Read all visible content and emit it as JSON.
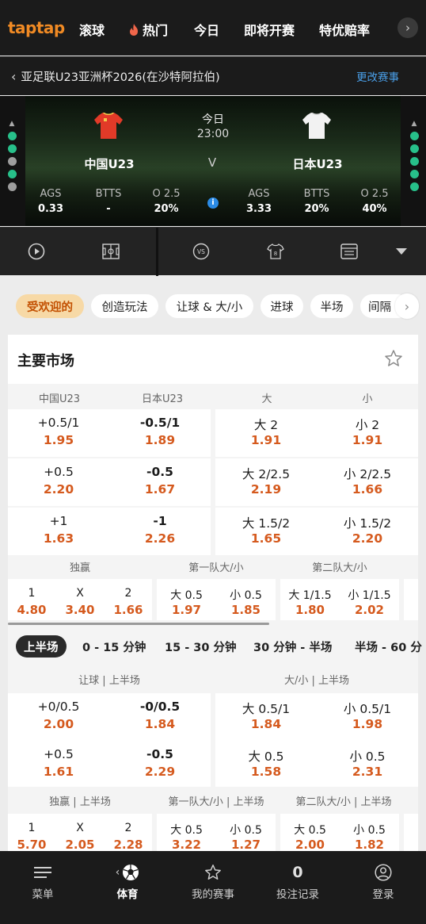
{
  "topnav": {
    "logo": "taptap",
    "items": [
      "滚球",
      "热门",
      "今日",
      "即将开赛",
      "特优赔率"
    ],
    "hot_icon": "flame-icon",
    "more_icon": "chevron-right-icon"
  },
  "breadcrumb": {
    "back_icon": "chevron-left-icon",
    "title": "亚足联U23亚洲杯2026(在沙特阿拉伯)",
    "change_link": "更改赛事"
  },
  "match": {
    "day": "今日",
    "time": "23:00",
    "vs": "V",
    "home": {
      "name": "中国U23",
      "jersey_color": "#e23a28",
      "collar_color": "#f2c94c"
    },
    "away": {
      "name": "日本U23",
      "jersey_color": "#f2f2f2",
      "collar_color": "#d9d9d9"
    },
    "home_form": [
      "#27c08a",
      "#27c08a",
      "#9e9e9e",
      "#27c08a",
      "#9e9e9e"
    ],
    "away_form": [
      "#27c08a",
      "#27c08a",
      "#27c08a",
      "#27c08a",
      "#27c08a"
    ],
    "stats_home": [
      {
        "label": "AGS",
        "value": "0.33"
      },
      {
        "label": "BTTS",
        "value": "-"
      },
      {
        "label": "O 2.5",
        "value": "20%"
      }
    ],
    "stats_away": [
      {
        "label": "AGS",
        "value": "3.33"
      },
      {
        "label": "BTTS",
        "value": "20%"
      },
      {
        "label": "O 2.5",
        "value": "40%"
      }
    ],
    "info_icon": "info-icon"
  },
  "iconbar": [
    "play-icon",
    "pitch-icon",
    "vs-icon",
    "jersey-icon",
    "scoreboard-icon",
    "dropdown-triangle-icon"
  ],
  "chips": [
    "受欢迎的",
    "创造玩法",
    "让球 & 大/小",
    "进球",
    "半场",
    "间隔"
  ],
  "main_market": {
    "title": "主要市场",
    "col_headers": [
      "中国U23",
      "日本U23",
      "大",
      "小"
    ],
    "handicap_rows": [
      {
        "home_line": "+0.5/1",
        "home_odds": "1.95",
        "away_line": "-0.5/1",
        "away_odds": "1.89",
        "over_line": "大 2",
        "over_odds": "1.91",
        "under_line": "小 2",
        "under_odds": "1.91"
      },
      {
        "home_line": "+0.5",
        "home_odds": "2.20",
        "away_line": "-0.5",
        "away_odds": "1.67",
        "over_line": "大 2/2.5",
        "over_odds": "2.19",
        "under_line": "小 2/2.5",
        "under_odds": "1.66"
      },
      {
        "home_line": "+1",
        "home_odds": "1.63",
        "away_line": "-1",
        "away_odds": "2.26",
        "over_line": "大 1.5/2",
        "over_odds": "1.65",
        "under_line": "小 1.5/2",
        "under_odds": "2.20"
      }
    ],
    "group_headers": [
      "独赢",
      "第一队大/小",
      "第二队大/小"
    ],
    "moneyline": [
      {
        "label": "1",
        "odds": "4.80"
      },
      {
        "label": "X",
        "odds": "3.40"
      },
      {
        "label": "2",
        "odds": "1.66"
      }
    ],
    "team1_ou": [
      {
        "label": "大 0.5",
        "odds": "1.97"
      },
      {
        "label": "小 0.5",
        "odds": "1.85"
      }
    ],
    "team2_ou": [
      {
        "label": "大 1/1.5",
        "odds": "1.80"
      },
      {
        "label": "小 1/1.5",
        "odds": "2.02"
      }
    ]
  },
  "period_tabs": [
    "上半场",
    "0 - 15 分钟",
    "15 - 30 分钟",
    "30 分钟 - 半场",
    "半场 - 60 分"
  ],
  "first_half": {
    "header_handicap": "让球 | 上半场",
    "header_ou": "大/小 | 上半场",
    "rows": [
      {
        "home_line": "+0/0.5",
        "home_odds": "2.00",
        "away_line": "-0/0.5",
        "away_odds": "1.84",
        "over_line": "大 0.5/1",
        "over_odds": "1.84",
        "under_line": "小 0.5/1",
        "under_odds": "1.98"
      },
      {
        "home_line": "+0.5",
        "home_odds": "1.61",
        "away_line": "-0.5",
        "away_odds": "2.29",
        "over_line": "大 0.5",
        "over_odds": "1.58",
        "under_line": "小 0.5",
        "under_odds": "2.31"
      }
    ],
    "group_headers": [
      "独赢 | 上半场",
      "第一队大/小 | 上半场",
      "第二队大/小 | 上半场"
    ],
    "moneyline": [
      {
        "label": "1",
        "odds": "5.70"
      },
      {
        "label": "X",
        "odds": "2.05"
      },
      {
        "label": "2",
        "odds": "2.28"
      }
    ],
    "team1_ou": [
      {
        "label": "大 0.5",
        "odds": "3.22"
      },
      {
        "label": "小 0.5",
        "odds": "1.27"
      }
    ],
    "team2_ou": [
      {
        "label": "大 0.5",
        "odds": "2.00"
      },
      {
        "label": "小 0.5",
        "odds": "1.82"
      }
    ]
  },
  "bottomnav": [
    {
      "label": "菜单",
      "icon": "menu-icon"
    },
    {
      "label": "体育",
      "icon": "soccer-ball-icon",
      "active": true
    },
    {
      "label": "我的赛事",
      "icon": "star-icon"
    },
    {
      "label": "投注记录",
      "icon": "bet-count-icon",
      "count": "0"
    },
    {
      "label": "登录",
      "icon": "user-icon"
    }
  ]
}
